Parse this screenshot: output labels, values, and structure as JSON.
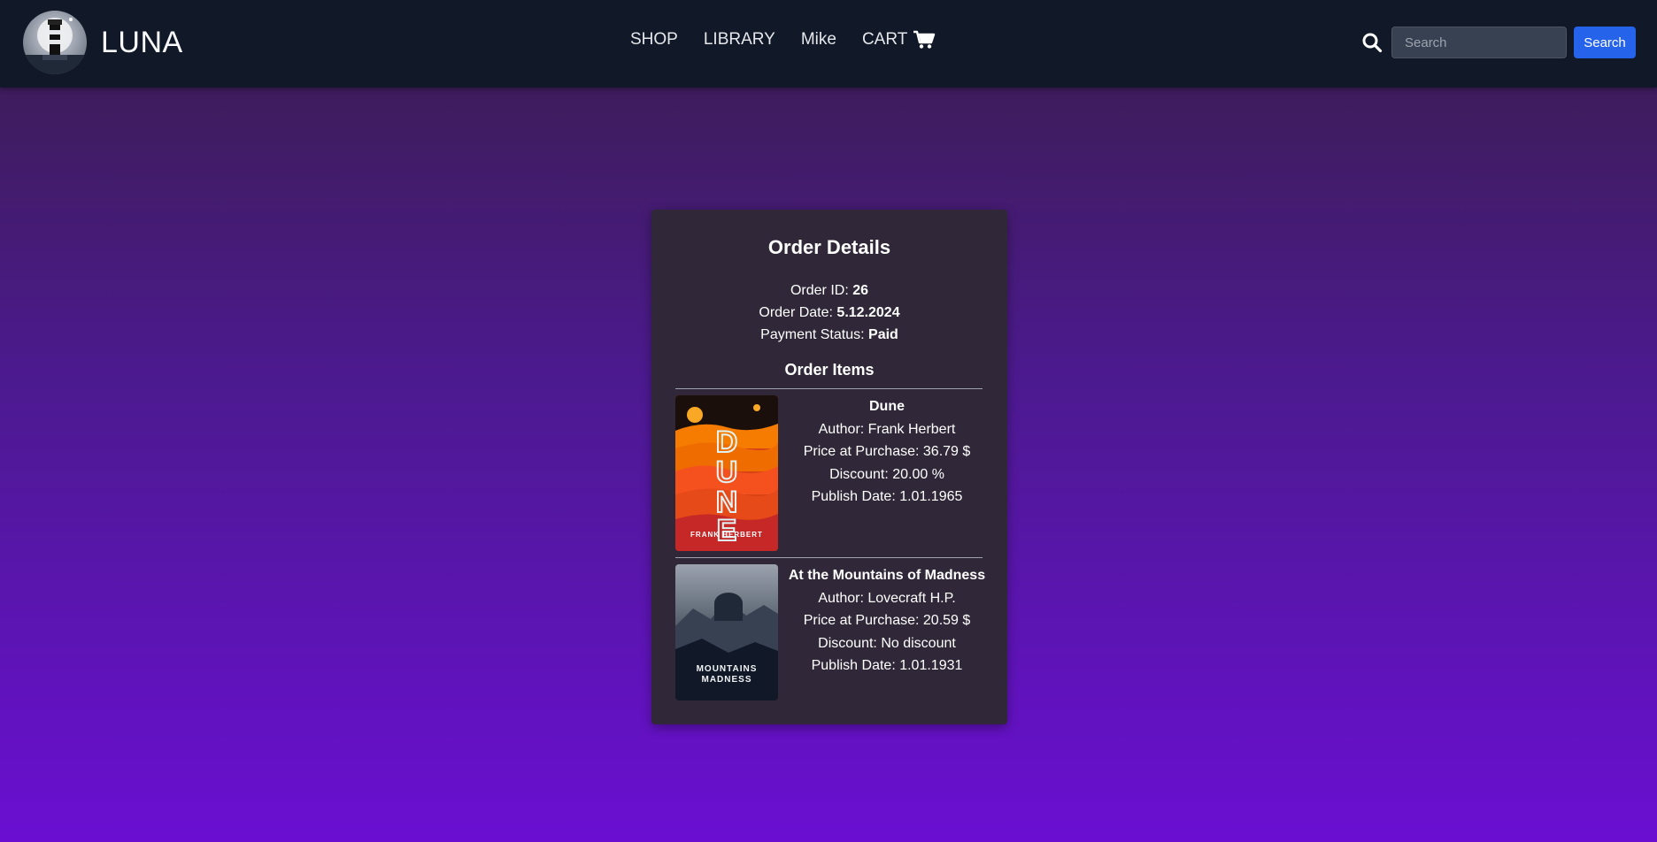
{
  "header": {
    "brand": "LUNA",
    "nav": [
      "SHOP",
      "LIBRARY",
      "Mike",
      "CART"
    ],
    "search_placeholder": "Search",
    "search_button": "Search"
  },
  "order": {
    "title": "Order Details",
    "id_label": "Order ID:",
    "id": "26",
    "date_label": "Order Date:",
    "date": "5.12.2024",
    "status_label": "Payment Status:",
    "status": "Paid",
    "items_title": "Order Items",
    "items": [
      {
        "title": "Dune",
        "author": "Author: Frank Herbert",
        "price": "Price at Purchase: 36.79 $",
        "discount": "Discount: 20.00 %",
        "publish": "Publish Date: 1.01.1965",
        "cover_author": "FRANK HERBERT"
      },
      {
        "title": "At the Mountains of Madness",
        "author": "Author: Lovecraft H.P.",
        "price": "Price at Purchase: 20.59 $",
        "discount": "Discount: No discount",
        "publish": "Publish Date: 1.01.1931",
        "cover_line1": "MOUNTAINS",
        "cover_line2": "MADNESS"
      }
    ]
  },
  "colors": {
    "navbar": "#111827",
    "accent": "#2563eb",
    "card": "#302838"
  },
  "icons": [
    "lighthouse-logo",
    "cart-icon",
    "search-icon"
  ]
}
